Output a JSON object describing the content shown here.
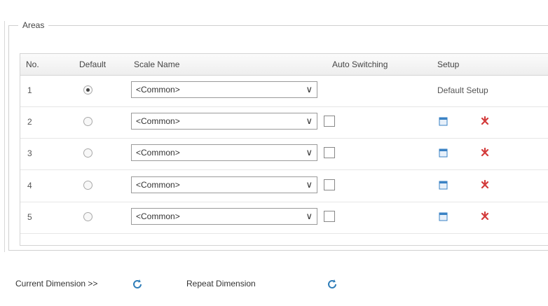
{
  "fieldset": {
    "legend": "Areas"
  },
  "table": {
    "headers": {
      "no": "No.",
      "default": "Default",
      "scale": "Scale Name",
      "auto": "Auto Switching",
      "setup": "Setup"
    },
    "rows": [
      {
        "no": "1",
        "selected": true,
        "scale": "<Common>",
        "auto_visible": false,
        "setup_text": "Default Setup"
      },
      {
        "no": "2",
        "selected": false,
        "scale": "<Common>",
        "auto_visible": true,
        "setup_text": ""
      },
      {
        "no": "3",
        "selected": false,
        "scale": "<Common>",
        "auto_visible": true,
        "setup_text": ""
      },
      {
        "no": "4",
        "selected": false,
        "scale": "<Common>",
        "auto_visible": true,
        "setup_text": ""
      },
      {
        "no": "5",
        "selected": false,
        "scale": "<Common>",
        "auto_visible": true,
        "setup_text": ""
      }
    ]
  },
  "footer": {
    "current_dimension": "Current Dimension >>",
    "repeat_dimension": "Repeat Dimension"
  },
  "icons": {
    "setup": "edit-icon",
    "pin": "pin-icon",
    "refresh": "refresh-icon"
  },
  "colors": {
    "edit_icon": "#3a82c4",
    "pin_icon": "#d33b3b"
  }
}
